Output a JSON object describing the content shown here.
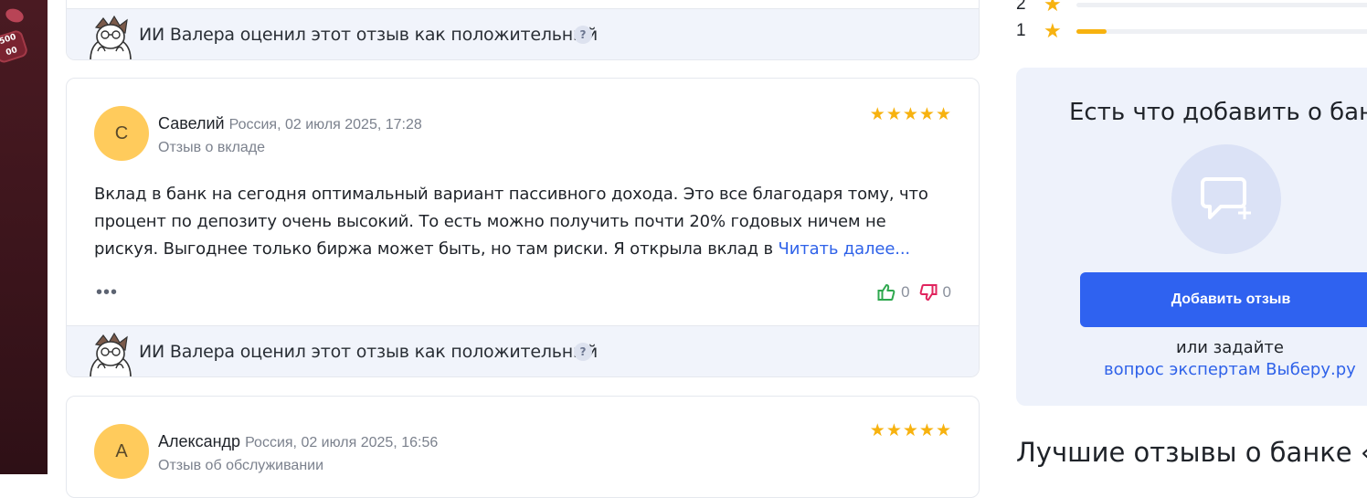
{
  "reviews": [
    {
      "ai_text": "ИИ Валера оценил этот отзыв как положительный",
      "help": "?"
    },
    {
      "avatar_letter": "С",
      "author": "Савелий",
      "meta": "Россия, 02 июля 2025, 17:28",
      "subtitle": "Отзыв о вкладе",
      "rating": 5,
      "text": "Вклад в банк на сегодня оптимальный вариант пассивного дохода. Это все благодаря тому, что процент по депозиту очень высокий. То есть можно получить почти 20% годовых ничем не рискуя. Выгоднее только биржа может быть, но там риски. Я открыла вклад в ",
      "read_more": "Читать далее...",
      "more": "•••",
      "likes": "0",
      "dislikes": "0",
      "ai_text": "ИИ Валера оценил этот отзыв как положительный",
      "help": "?"
    },
    {
      "avatar_letter": "А",
      "author": "Александр",
      "meta": "Россия, 02 июля 2025, 16:56",
      "subtitle": "Отзыв об обслуживании",
      "rating": 5
    }
  ],
  "rating_breakdown": [
    {
      "stars": "2",
      "fraction": 0.0
    },
    {
      "stars": "1",
      "fraction": 0.1
    }
  ],
  "add_review": {
    "title": "Есть что добавить о банке",
    "button": "Добавить отзыв",
    "or": "или задайте",
    "link": "вопрос экспертам Выберу.ру"
  },
  "best_reviews_title": "Лучшие отзывы о банке «Ал",
  "colors": {
    "star": "#f7b20f",
    "like": "#2fa84f",
    "dislike": "#e0245e",
    "accent": "#2f62f0",
    "avatar": "#ffcb5c"
  }
}
